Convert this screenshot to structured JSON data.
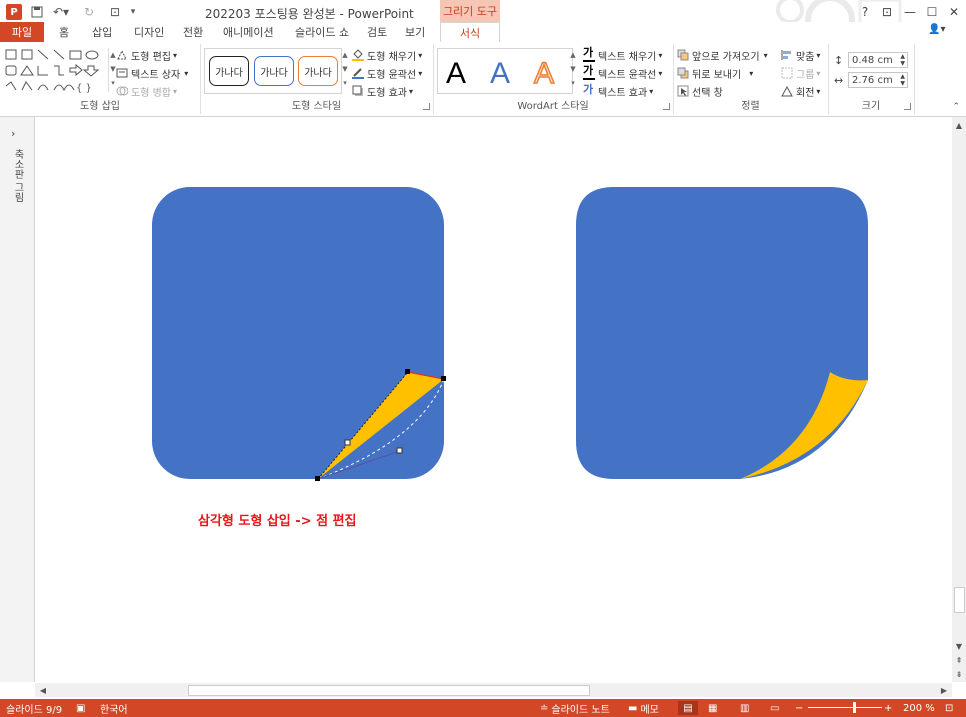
{
  "title_bar": {
    "app_icon_text": "P",
    "save_icon": "save-icon",
    "undo_icon": "undo-icon",
    "redo_icon": "redo-icon",
    "customize_icon": "start-icon",
    "document_title": "202203 포스팅용 완성본 - PowerPoint",
    "contextual_tab_group": "그리기 도구",
    "help": "?",
    "restore_ribbon": "⊡",
    "minimize": "—",
    "maximize": "☐",
    "close": "✕"
  },
  "tabs": [
    "파일",
    "홈",
    "삽입",
    "디자인",
    "전환",
    "애니메이션",
    "슬라이드 쇼",
    "검토",
    "보기",
    "서식"
  ],
  "active_tab": "서식",
  "ribbon": {
    "insert_shapes": {
      "label": "도형 삽입",
      "edit_shape": "도형 편집",
      "text_box": "텍스트 상자",
      "merge_shapes": "도형 병합"
    },
    "shape_styles": {
      "label": "도형 스타일",
      "samples": [
        "가나다",
        "가나다",
        "가나다"
      ],
      "fill": "도형 채우기",
      "outline": "도형 윤곽선",
      "effects": "도형 효과"
    },
    "wordart_styles": {
      "label": "WordArt 스타일",
      "samples": [
        "A",
        "A",
        "A"
      ],
      "text_fill": "텍스트 채우기",
      "text_outline": "텍스트 윤곽선",
      "text_effects": "텍스트 효과"
    },
    "arrange": {
      "label": "정렬",
      "bring_forward": "앞으로 가져오기",
      "send_backward": "뒤로 보내기",
      "selection_pane": "선택 창",
      "align": "맞춤",
      "group": "그룹",
      "rotate": "회전"
    },
    "size": {
      "label": "크기",
      "height": "0.48 cm",
      "width": "2.76 cm"
    }
  },
  "left_pane": {
    "label": "축소판 그림"
  },
  "slide": {
    "caption": "삼각형 도형 삽입 -> 점 편집",
    "shape_color": "#4472c4",
    "fold_color": "#ffc000"
  },
  "status_bar": {
    "slide_number": "슬라이드 9/9",
    "language": "한국어",
    "notes": "슬라이드 노트",
    "comments": "메모",
    "zoom_level": "200 %"
  }
}
